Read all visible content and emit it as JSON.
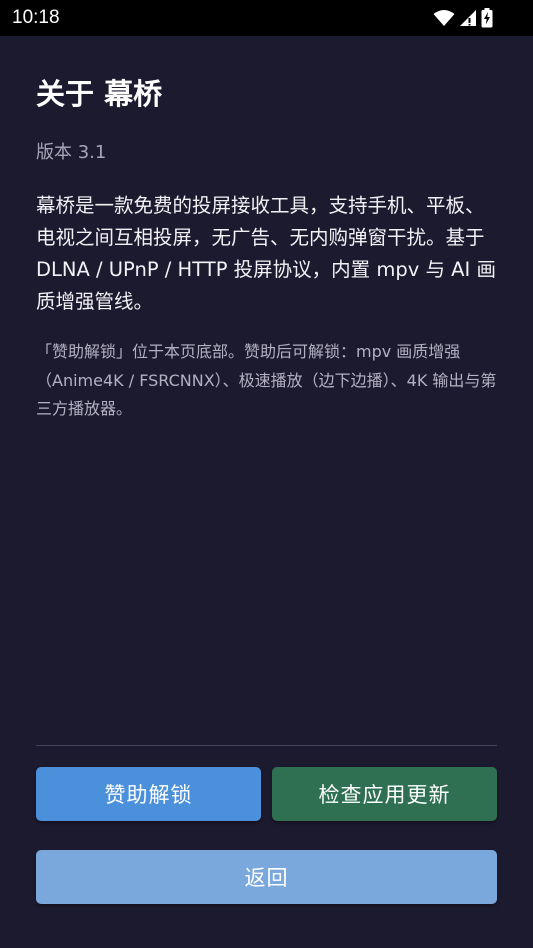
{
  "status_bar": {
    "time": "10:18",
    "icons": [
      "wifi-icon",
      "signal-icon",
      "battery-charging-icon"
    ]
  },
  "about": {
    "title": "关于 幕桥",
    "version": "版本 3.1",
    "description": "幕桥是一款免费的投屏接收工具，支持手机、平板、电视之间互相投屏，无广告、无内购弹窗干扰。基于 DLNA / UPnP / HTTP 投屏协议，内置 mpv 与 AI 画质增强管线。",
    "sponsor_note": "「赞助解锁」位于本页底部。赞助后可解锁：mpv 画质增强（Anime4K / FSRCNNX）、极速播放（边下边播）、4K 输出与第三方播放器。"
  },
  "buttons": {
    "sponsor_label": "赞助解锁",
    "update_label": "检查应用更新",
    "back_label": "返回"
  },
  "colors": {
    "background": "#1c1a2e",
    "sponsor_button": "#4a90db",
    "update_button": "#2e7051",
    "back_button": "#7aa8dc"
  }
}
